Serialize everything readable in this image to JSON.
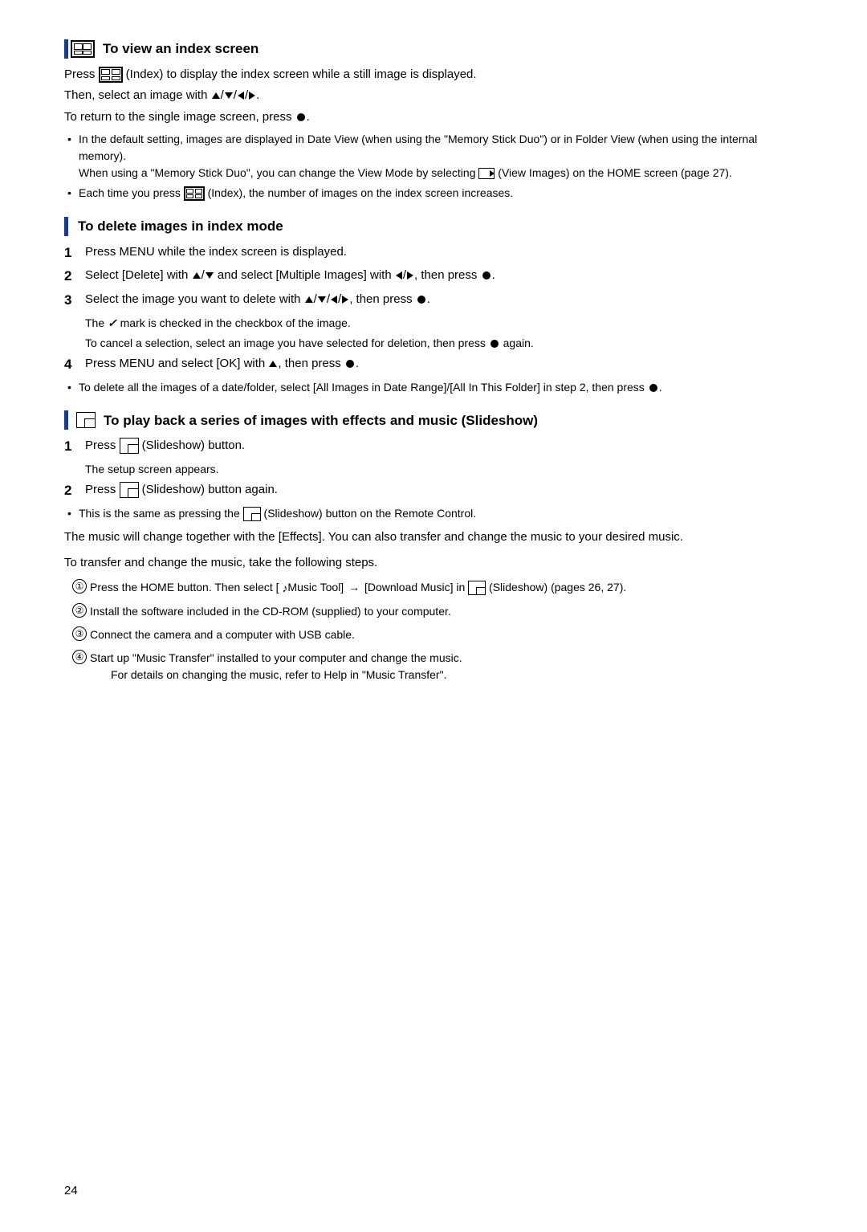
{
  "page": {
    "number": "24",
    "sections": [
      {
        "id": "index-screen",
        "heading": "To view an index screen",
        "has_index_icon": true,
        "paragraphs": [
          "Press [IDX] (Index) to display the index screen while a still image is displayed.",
          "Then, select an image with ▲/▼/◄/►.",
          "To return to the single image screen, press ●."
        ],
        "bullets": [
          "In the default setting, images are displayed in Date View (when using the \"Memory Stick Duo\") or in Folder View (when using the internal memory). When using a \"Memory Stick Duo\", you can change the View Mode by selecting [VIEW] (View Images) on the HOME screen (page 27).",
          "Each time you press [IDX] (Index), the number of images on the index screen increases."
        ]
      },
      {
        "id": "delete-images",
        "heading": "To delete images in index mode",
        "has_bar_icon": true,
        "steps": [
          "Press MENU while the index screen is displayed.",
          "Select [Delete] with ▲/▼ and select [Multiple Images] with ◄/►, then press ●.",
          "Select the image you want to delete with ▲/▼/◄/►, then press ●."
        ],
        "step_notes": [
          "The ✓ mark is checked in the checkbox of the image.",
          "To cancel a selection, select an image you have selected for deletion, then press ● again."
        ],
        "step4": "Press MENU and select [OK] with ▲, then press ●.",
        "extra_bullet": "To delete all the images of a date/folder, select [All Images in Date Range]/[All In This Folder] in step 2, then press ●."
      },
      {
        "id": "slideshow",
        "heading": "To play back a series of images with effects and music (Slideshow)",
        "has_slideshow_icon": true,
        "steps": [
          {
            "num": "1",
            "text": "Press [SLIDE] (Slideshow) button.",
            "note": "The setup screen appears."
          },
          {
            "num": "2",
            "text": "Press [SLIDE] (Slideshow) button again."
          }
        ],
        "bullet": "This is the same as pressing the [SLIDE] (Slideshow) button on the Remote Control.",
        "paragraphs": [
          "The music will change together with the [Effects]. You can also transfer and change the music to your desired music.",
          "To transfer and change the music, take the following steps."
        ],
        "circle_items": [
          {
            "num": "1",
            "text": "Press the HOME button. Then select [ ♪Music Tool] → [Download Music] in [SLIDE] (Slideshow) (pages 26, 27)."
          },
          {
            "num": "2",
            "text": "Install the software included in the CD-ROM (supplied) to your computer."
          },
          {
            "num": "3",
            "text": "Connect the camera and a computer with USB cable."
          },
          {
            "num": "4",
            "text": "Start up \"Music Transfer\" installed to your computer and change the music.",
            "sub": "For details on changing the music, refer to Help in \"Music Transfer\"."
          }
        ]
      }
    ]
  }
}
